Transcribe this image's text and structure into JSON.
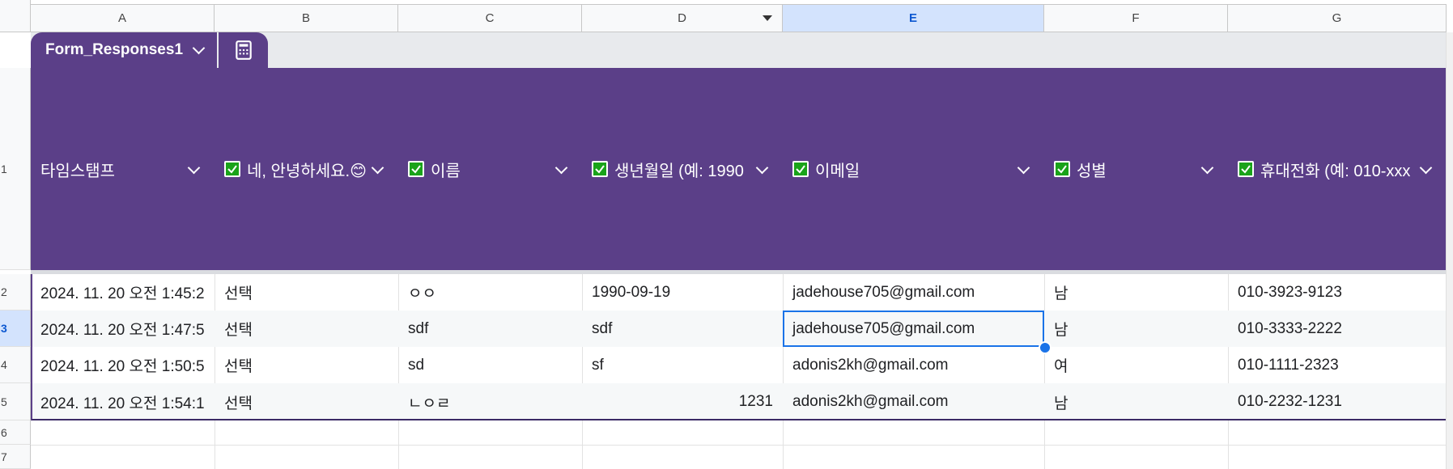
{
  "columns": [
    "A",
    "B",
    "C",
    "D",
    "E",
    "F",
    "G"
  ],
  "selected_column": "E",
  "row_numbers": [
    "1",
    "2",
    "3",
    "4",
    "5",
    "6",
    "7"
  ],
  "selected_row": "3",
  "table": {
    "name": "Form_Responses1",
    "headers": [
      {
        "label": "타임스탬프",
        "checkbox": false
      },
      {
        "label": "네, 안녕하세요.😊",
        "checkbox": true
      },
      {
        "label": "이름",
        "checkbox": true
      },
      {
        "label": "생년월일 (예: 1990",
        "checkbox": true
      },
      {
        "label": "이메일",
        "checkbox": true
      },
      {
        "label": "성별",
        "checkbox": true
      },
      {
        "label": "휴대전화 (예: 010-xxx",
        "checkbox": true
      }
    ],
    "rows": [
      [
        "2024. 11. 20 오전 1:45:2",
        "선택",
        "ㅇㅇ",
        "1990-09-19",
        "jadehouse705@gmail.com",
        "남",
        "010-3923-9123"
      ],
      [
        "2024. 11. 20 오전 1:47:5",
        "선택",
        "sdf",
        "sdf",
        "jadehouse705@gmail.com",
        "남",
        "010-3333-2222"
      ],
      [
        "2024. 11. 20 오전 1:50:5",
        "선택",
        "sd",
        "sf",
        "adonis2kh@gmail.com",
        "여",
        "010-1111-2323"
      ],
      [
        "2024. 11. 20 오전 1:54:1",
        "선택",
        "ㄴㅇㄹ",
        "1231",
        "adonis2kh@gmail.com",
        "남",
        "010-2232-1231"
      ]
    ]
  },
  "colors": {
    "table_header": "#5b3f88",
    "selection": "#1a73e8",
    "checkbox": "#1aa31a"
  },
  "icons": {
    "table_menu": "chevron-down-icon",
    "calculator": "calculator-icon",
    "filter": "filter-dropdown-icon"
  }
}
